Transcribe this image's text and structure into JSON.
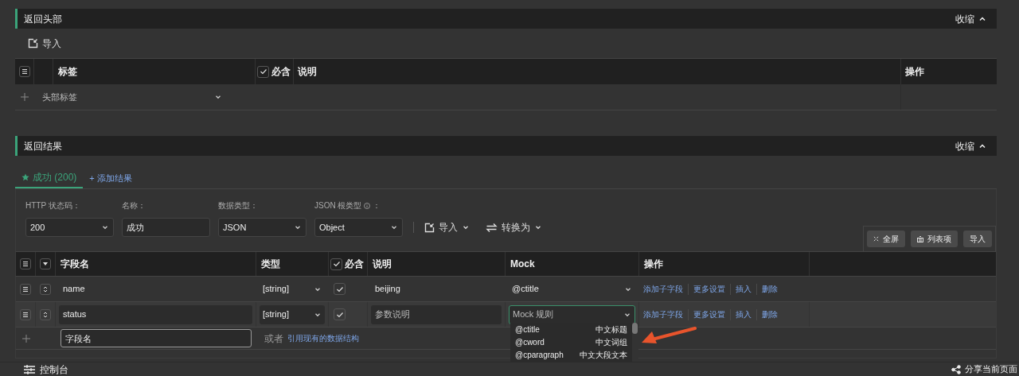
{
  "header_section": {
    "title": "返回头部",
    "collapse": "收缩",
    "import": "导入",
    "columns": [
      {
        "label": "标签"
      },
      {
        "label": "必含",
        "checked": true
      },
      {
        "label": "说明"
      },
      {
        "label": "操作"
      }
    ],
    "new_row": {
      "placeholder": "头部标签"
    }
  },
  "result_section": {
    "title": "返回结果",
    "collapse": "收缩",
    "tabs": [
      {
        "label": "成功 (200)",
        "selected": true
      }
    ],
    "add_result": "+ 添加结果",
    "fields": [
      {
        "label": "HTTP 状态码：",
        "value": "200",
        "kind": "select"
      },
      {
        "label": "名称：",
        "value": "成功",
        "kind": "input"
      },
      {
        "label": "数据类型：",
        "value": "JSON",
        "kind": "select"
      },
      {
        "label": "JSON 根类型",
        "info": true,
        "after": "：",
        "value": "Object",
        "kind": "select"
      }
    ],
    "toolbar": [
      {
        "label": "导入",
        "kind": "import"
      },
      {
        "label": "转换为",
        "kind": "convert"
      }
    ],
    "table_tools": [
      {
        "label": "全屏",
        "kind": "fullscreen"
      },
      {
        "label": "列表项",
        "kind": "columns"
      },
      {
        "label": "导入",
        "kind": "plain"
      }
    ],
    "columns": [
      {
        "label": "字段名"
      },
      {
        "label": "类型"
      },
      {
        "label": "必含",
        "checked": true
      },
      {
        "label": "说明"
      },
      {
        "label": "Mock"
      },
      {
        "label": "操作"
      }
    ],
    "rows": [
      {
        "name": "name",
        "type": "[string]",
        "required": true,
        "description": "beijing",
        "mock": "@ctitle",
        "editing": false,
        "actions": [
          "添加子字段",
          "更多设置",
          "插入",
          "删除"
        ]
      },
      {
        "name": "status",
        "type": "[string]",
        "required": true,
        "description_placeholder": "参数说明",
        "mock_placeholder": "Mock 规则",
        "editing": true,
        "actions": [
          "添加子字段",
          "更多设置",
          "插入",
          "删除"
        ]
      }
    ],
    "new_row": {
      "placeholder": "字段名",
      "or": "或者",
      "link": "引用现有的数据结构"
    },
    "mock_options": [
      {
        "rule": "@ctitle",
        "desc": "中文标题"
      },
      {
        "rule": "@cword",
        "desc": "中文词组"
      },
      {
        "rule": "@cparagraph",
        "desc": "中文大段文本"
      }
    ]
  },
  "bottom_bar": {
    "console": "控制台",
    "share": "分享当前页面"
  }
}
